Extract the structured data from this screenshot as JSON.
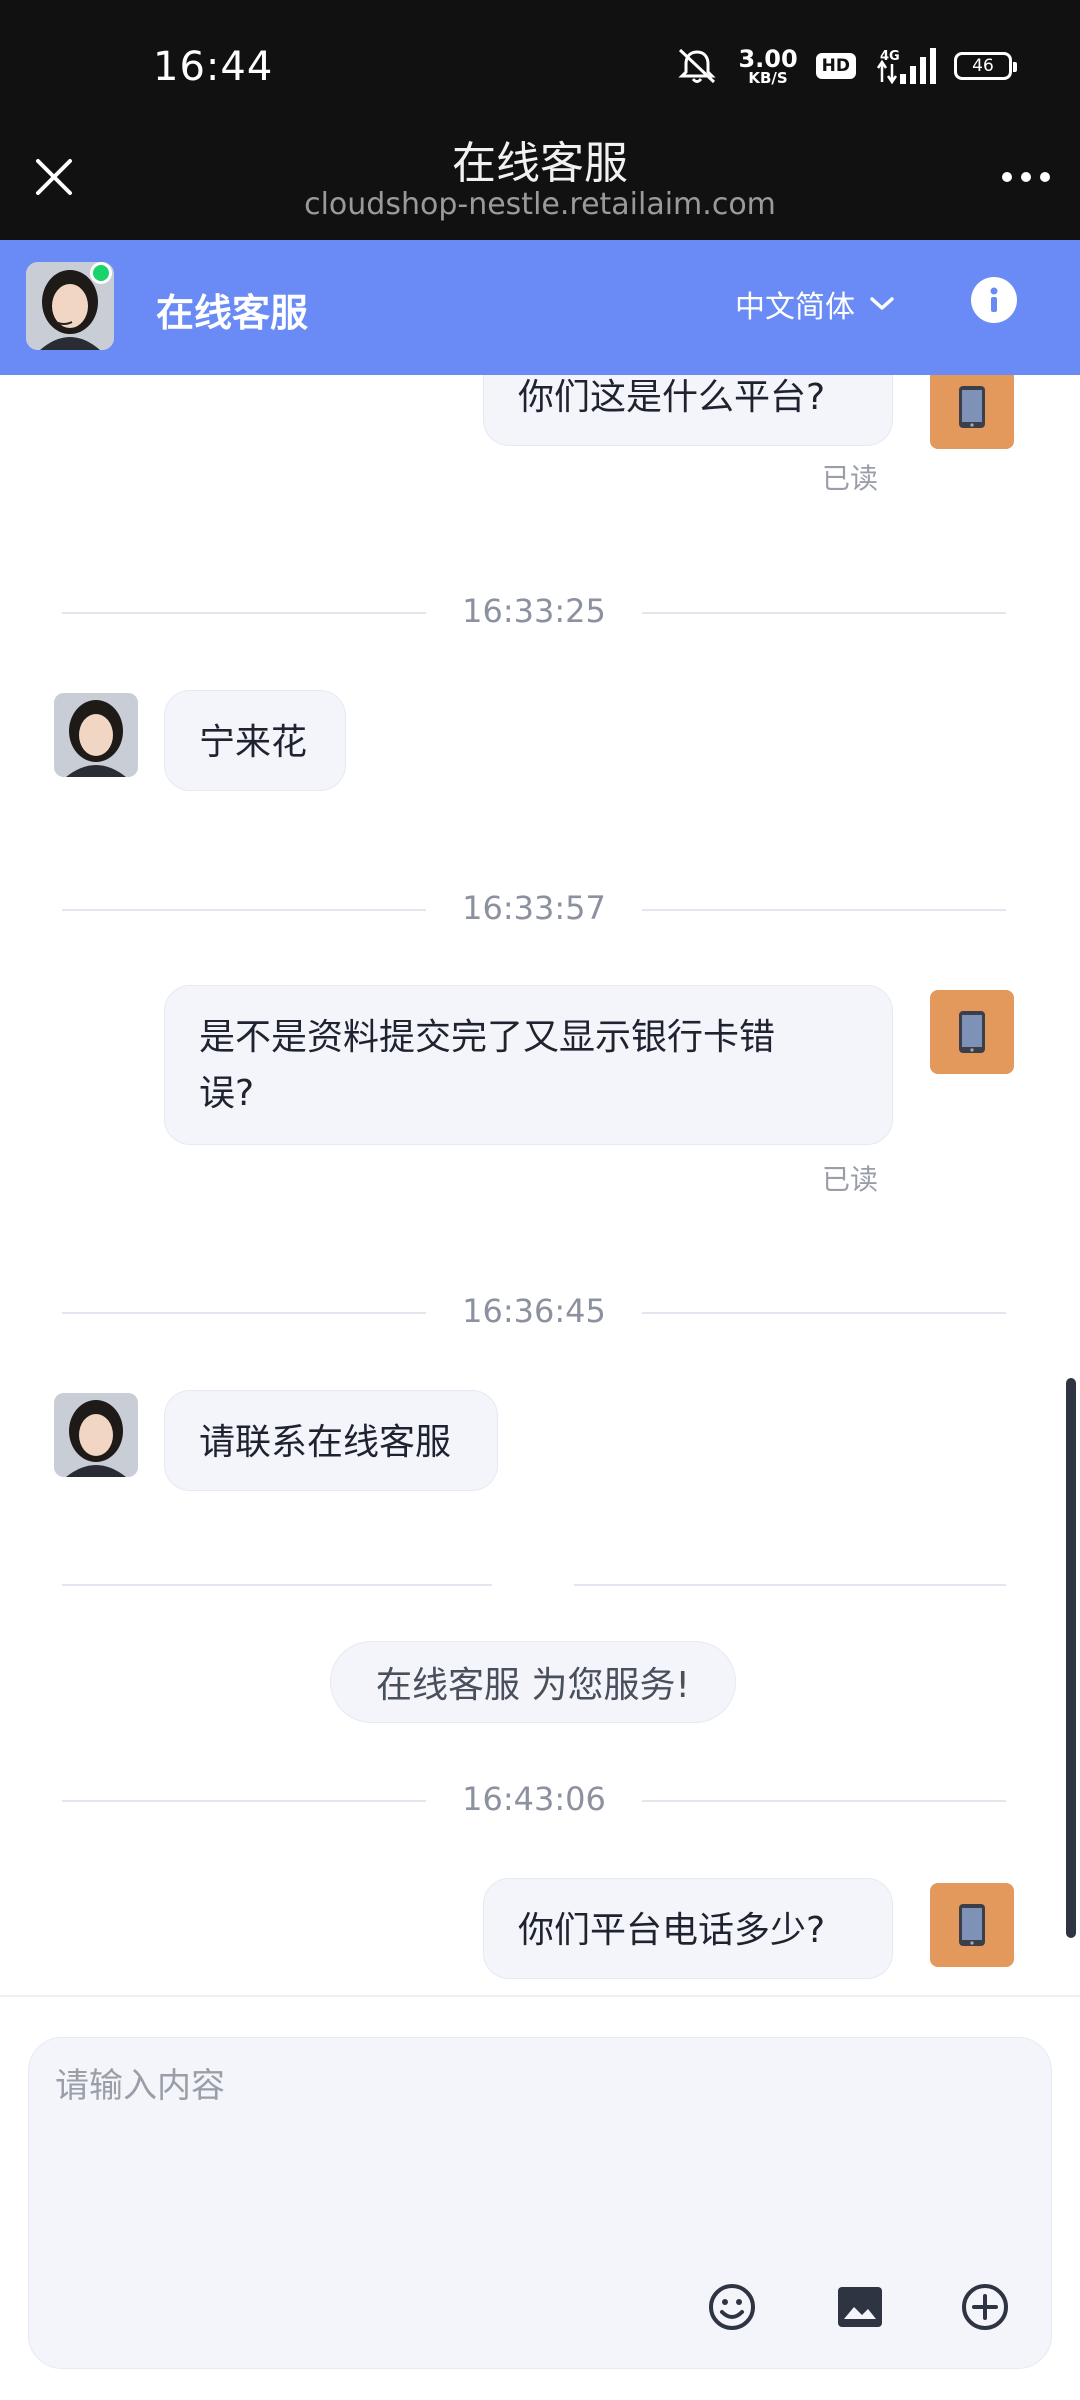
{
  "status_bar": {
    "time": "16:44",
    "net_speed_value": "3.00",
    "net_speed_unit": "KB/S",
    "hd_label": "HD",
    "network_label": "4G",
    "battery": "46"
  },
  "browser": {
    "title": "在线客服",
    "url": "cloudshop-nestle.retailaim.com"
  },
  "header": {
    "title": "在线客服",
    "language": "中文简体",
    "accent_color": "#6a8bf5"
  },
  "messages": [
    {
      "sender": "user",
      "text": "你们这是什么平台?",
      "read": "已读"
    },
    {
      "time": "16:33:25"
    },
    {
      "sender": "agent",
      "text": "宁来花"
    },
    {
      "time": "16:33:57"
    },
    {
      "sender": "user",
      "text_line1": "是不是资料提交完了又显示银行卡错",
      "text_line2": "误?",
      "read": "已读"
    },
    {
      "time": "16:36:45"
    },
    {
      "sender": "agent",
      "text": "请联系在线客服"
    },
    {
      "system": "在线客服 为您服务!"
    },
    {
      "time": "16:43:06"
    },
    {
      "sender": "user",
      "text": "你们平台电话多少?"
    }
  ],
  "input": {
    "placeholder": "请输入内容"
  },
  "icons": {
    "close": "close-icon",
    "more": "more-icon",
    "info": "info-icon",
    "chevron": "chevron-down-icon",
    "emoji": "emoji-icon",
    "image": "image-icon",
    "add": "add-circle-icon",
    "user_avatar": "phone-icon"
  }
}
